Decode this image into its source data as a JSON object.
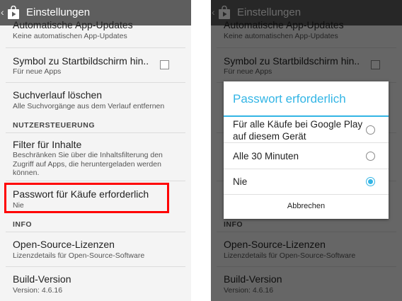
{
  "app": {
    "title": "Einstellungen",
    "back_glyph": "‹",
    "icon": "play-store-bag-icon"
  },
  "colors": {
    "accent": "#33b5e5",
    "highlight": "#ff0000",
    "topbar": "#5e5e5e"
  },
  "settings": {
    "auto_update": {
      "title": "Automatische App-Updates",
      "subtitle": "Keine automatischen App-Updates"
    },
    "shortcut": {
      "title": "Symbol zu Startbildschirm hin..",
      "subtitle": "Für neue Apps",
      "checked": false
    },
    "history": {
      "title": "Suchverlauf löschen",
      "subtitle": "Alle Suchvorgänge aus dem Verlauf entfernen"
    },
    "section_user_controls": "NUTZERSTEUERUNG",
    "content_filter": {
      "title": "Filter für Inhalte",
      "subtitle": "Beschränken Sie über die Inhaltsfilterung den Zugriff auf Apps, die heruntergeladen werden können."
    },
    "password": {
      "title": "Passwort für Käufe erforderlich",
      "subtitle": "Nie"
    },
    "section_info": "INFO",
    "licenses": {
      "title": "Open-Source-Lizenzen",
      "subtitle": "Lizenzdetails für Open-Source-Software"
    },
    "build": {
      "title": "Build-Version",
      "subtitle": "Version: 4.6.16"
    }
  },
  "dialog": {
    "title": "Passwort erforderlich",
    "options": [
      {
        "label": "Für alle Käufe bei Google Play auf diesem Gerät",
        "selected": false
      },
      {
        "label": "Alle 30 Minuten",
        "selected": false
      },
      {
        "label": "Nie",
        "selected": true
      }
    ],
    "cancel_label": "Abbrechen"
  }
}
